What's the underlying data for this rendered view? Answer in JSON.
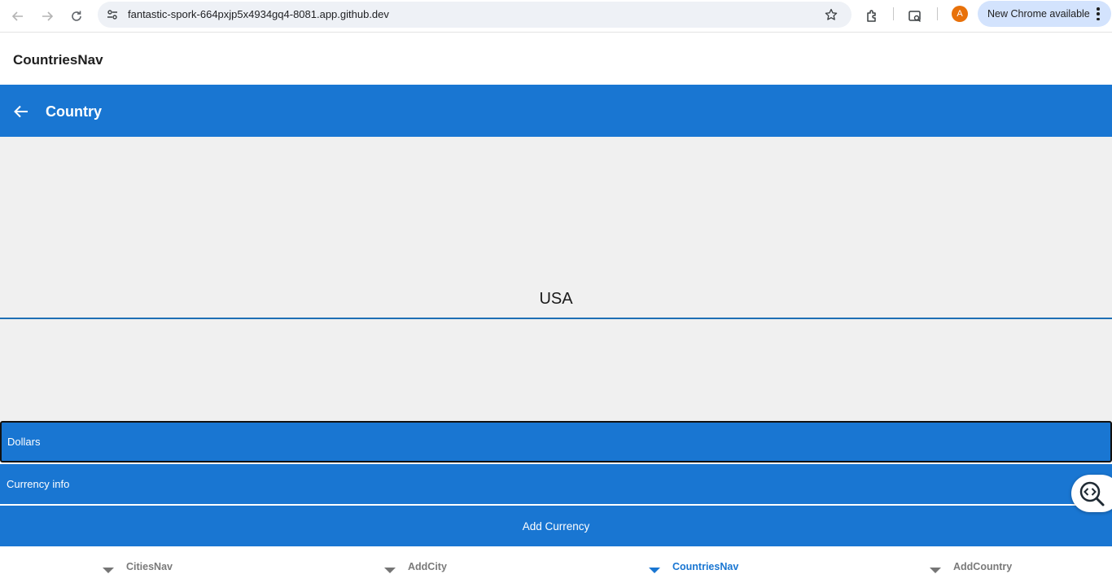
{
  "browser": {
    "url": "fantastic-spork-664pxjp5x4934gq4-8081.app.github.dev",
    "profile_initial": "A",
    "update_label": "New Chrome available",
    "icons": [
      "back-arrow-icon",
      "forward-arrow-icon",
      "reload-icon",
      "site-info-icon",
      "bookmark-star-icon",
      "extensions-icon",
      "tab-search-icon",
      "kebab-menu-icon"
    ]
  },
  "app": {
    "title": "CountriesNav"
  },
  "toolbar": {
    "title": "Country",
    "back_icon": "arrow-left-icon"
  },
  "main": {
    "country_name": "USA",
    "currency_value": "Dollars",
    "info_placeholder": "Currency info",
    "add_button_label": "Add Currency"
  },
  "tabs": [
    {
      "label": "CitiesNav",
      "active": false
    },
    {
      "label": "AddCity",
      "active": false
    },
    {
      "label": "CountriesNav",
      "active": true
    },
    {
      "label": "AddCountry",
      "active": false
    }
  ],
  "colors": {
    "primary": "#1976d2",
    "content_bg": "#f0f0f0",
    "inactive_tab": "#7a7a7a"
  }
}
